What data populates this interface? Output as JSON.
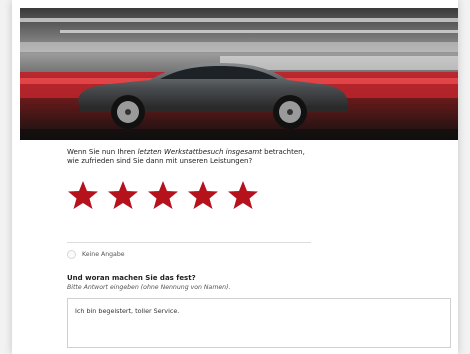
{
  "survey": {
    "question_prefix": "Wenn Sie nun Ihren ",
    "question_emphasis": "letzten Werkstattbesuch insgesamt",
    "question_suffix": " betrachten, wie zufrieden sind Sie dann mit unseren Leistungen?",
    "rating": {
      "max": 5,
      "value": 5,
      "star_color": "#b5121b"
    },
    "no_answer_label": "Keine Angabe",
    "followup_title": "Und woran machen Sie das fest?",
    "followup_hint": "Bitte Antwort eingeben (ohne Nennung von Namen).",
    "answer_text": "Ich bin begeistert, toller Service."
  },
  "colors": {
    "accent": "#b5121b",
    "page_background": "#f2f2f2"
  },
  "hero": {
    "image": "car-hero-image"
  }
}
